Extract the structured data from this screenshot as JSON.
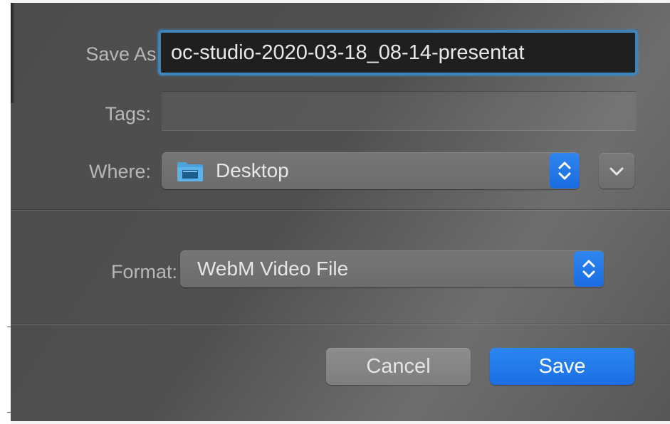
{
  "dialog": {
    "save_as": {
      "label": "Save As:",
      "value": "oc-studio-2020-03-18_08-14-presentat"
    },
    "tags": {
      "label": "Tags:",
      "value": ""
    },
    "where": {
      "label": "Where:",
      "value": "Desktop",
      "icon": "folder-icon"
    },
    "format": {
      "label": "Format:",
      "value": "WebM Video File"
    },
    "buttons": {
      "cancel": "Cancel",
      "save": "Save"
    },
    "colors": {
      "accent": "#1f72e6",
      "focus_ring": "#3f84b8",
      "folder": "#4aa3df"
    }
  }
}
